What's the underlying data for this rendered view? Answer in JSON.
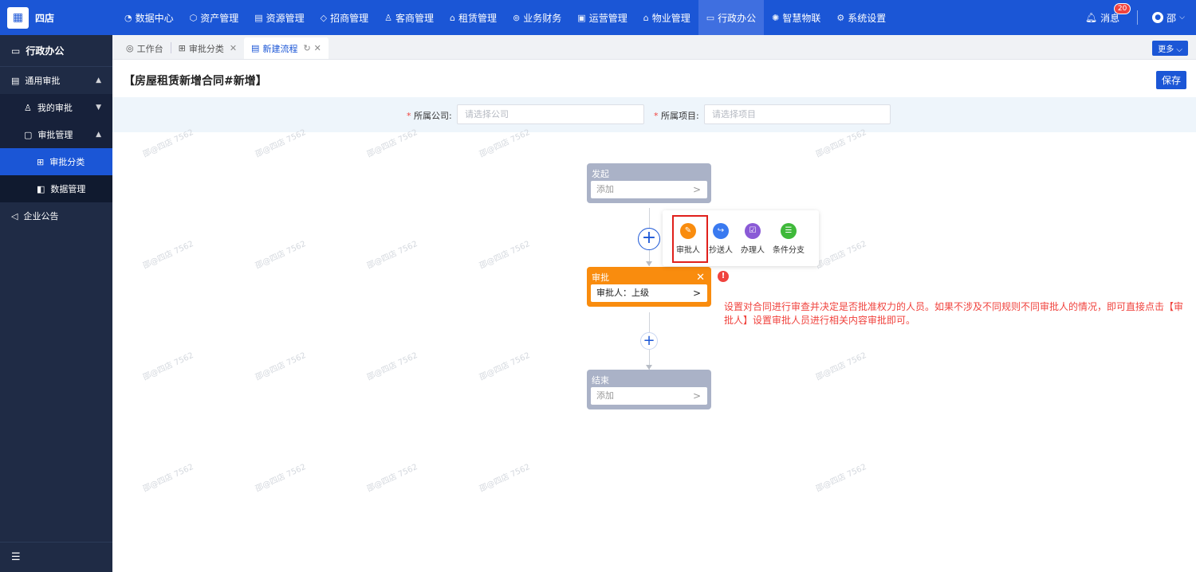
{
  "brand": {
    "name": "四店",
    "icon": "building-icon"
  },
  "nav": [
    {
      "label": "数据中心",
      "icon": "chart-icon",
      "active": false
    },
    {
      "label": "资产管理",
      "icon": "cube-icon",
      "active": false
    },
    {
      "label": "资源管理",
      "icon": "doc-icon",
      "active": false
    },
    {
      "label": "招商管理",
      "icon": "tag-icon",
      "active": false
    },
    {
      "label": "客商管理",
      "icon": "people-icon",
      "active": false
    },
    {
      "label": "租赁管理",
      "icon": "house-icon",
      "active": false
    },
    {
      "label": "业务财务",
      "icon": "coin-icon",
      "active": false
    },
    {
      "label": "运营管理",
      "icon": "grid-icon",
      "active": false
    },
    {
      "label": "物业管理",
      "icon": "home-icon",
      "active": false
    },
    {
      "label": "行政办公",
      "icon": "monitor-icon",
      "active": true
    },
    {
      "label": "智慧物联",
      "icon": "iot-icon",
      "active": false
    },
    {
      "label": "系统设置",
      "icon": "gear-icon",
      "active": false
    }
  ],
  "header_right": {
    "messages_label": "消息",
    "messages_count": "20",
    "user_name": "邵"
  },
  "sidebar": {
    "title": "行政办公",
    "items": [
      {
        "label": "通用审批"
      },
      {
        "label": "我的审批"
      },
      {
        "label": "审批管理"
      },
      {
        "label": "审批分类"
      },
      {
        "label": "数据管理"
      },
      {
        "label": "企业公告"
      }
    ]
  },
  "tabs": [
    {
      "label": "工作台"
    },
    {
      "label": "审批分类"
    },
    {
      "label": "新建流程"
    }
  ],
  "more_label": "更多",
  "page": {
    "title": "【房屋租赁新增合同#新增】",
    "save_label": "保存"
  },
  "filters": {
    "company_label": "所属公司:",
    "company_placeholder": "请选择公司",
    "project_label": "所属项目:",
    "project_placeholder": "请选择项目"
  },
  "flow": {
    "start": {
      "title": "发起",
      "value": "添加"
    },
    "approve": {
      "title": "审批",
      "value": "审批人：上级"
    },
    "end": {
      "title": "结束",
      "value": "添加"
    }
  },
  "popup_options": [
    {
      "label": "审批人",
      "color": "#f98c0e",
      "icon": "approver-icon"
    },
    {
      "label": "抄送人",
      "color": "#3a7af0",
      "icon": "cc-icon"
    },
    {
      "label": "办理人",
      "color": "#8a5ad6",
      "icon": "handler-icon"
    },
    {
      "label": "条件分支",
      "color": "#3fb93a",
      "icon": "branch-icon"
    }
  ],
  "note": "设置对合同进行审查并决定是否批准权力的人员。如果不涉及不同规则不同审批人的情况，即可直接点击【审批人】设置审批人员进行相关内容审批即可。",
  "watermark": "邵@四店 7562"
}
